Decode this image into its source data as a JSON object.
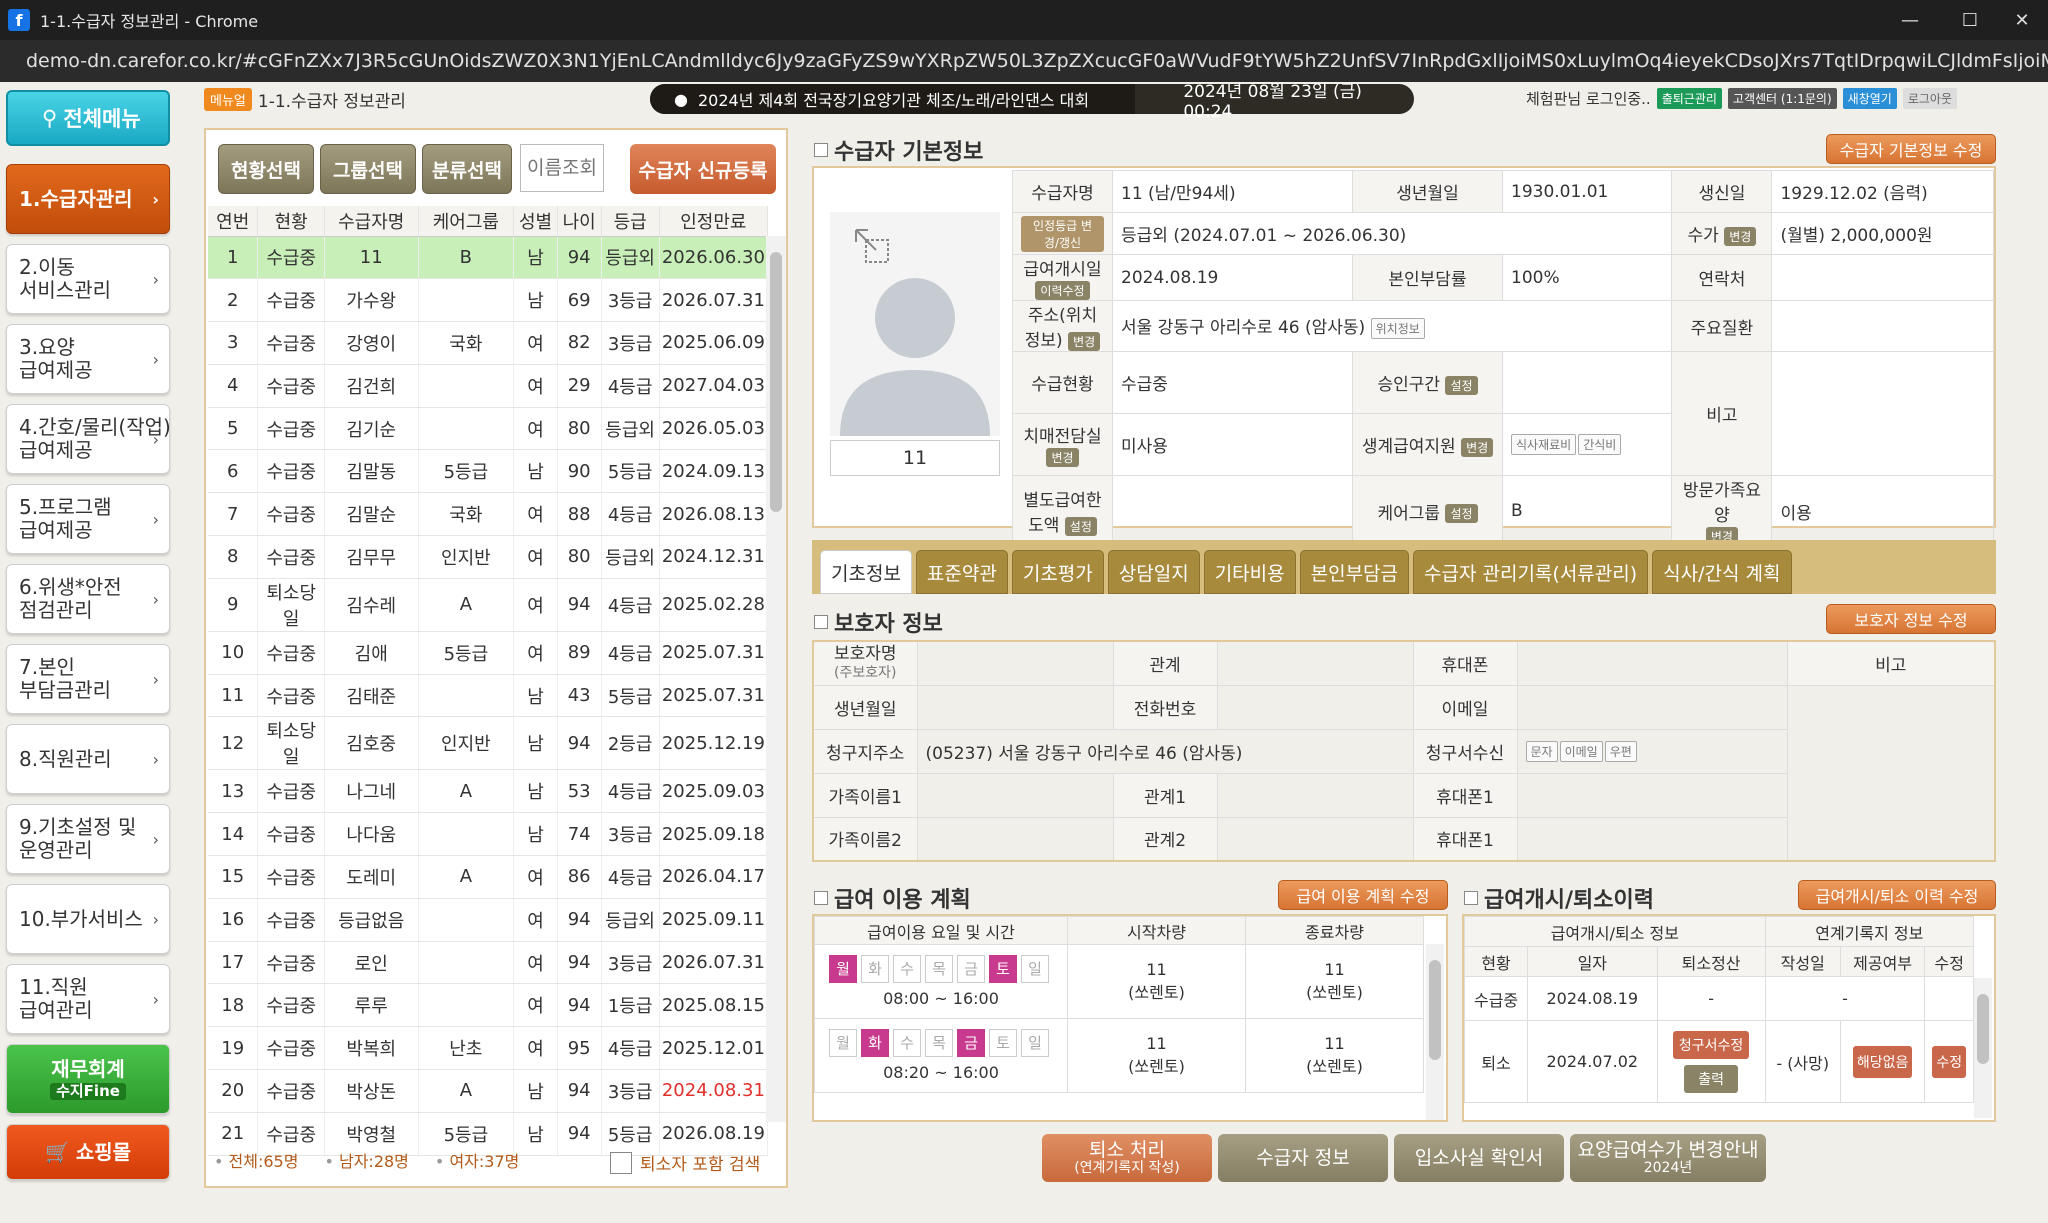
{
  "window": {
    "title": "1-1.수급자 정보관리 - Chrome",
    "url": "demo-dn.carefor.co.kr/#cGFnZXx7J3R5cGUnOidsZWZ0X3N1YjEnLCAndmlldyc6Jy9zaGFyZS9wYXRpZW50L3ZpZXcucGF0aWVudF9tYW5hZ2UnfSV7InRpdGxlIjoiMS0xLuylmOq4ieyekCDsoJXrs7TqtIDrpqwiLCJldmFsIjoiMSIsInNldHRpbmdzIjoiIn0="
  },
  "nav": {
    "menu_all": "전체메뉴",
    "items": [
      "1.수급자관리",
      "2.이동\n서비스관리",
      "3.요양\n급여제공",
      "4.간호/물리(작업)\n급여제공",
      "5.프로그램\n급여제공",
      "6.위생*안전\n점검관리",
      "7.본인\n부담금관리",
      "8.직원관리",
      "9.기초설정 및\n운영관리",
      "10.부가서비스",
      "11.직원\n급여관리"
    ],
    "finance": "재무회계",
    "finance_sub": "수지Fine",
    "shop": "쇼핑몰"
  },
  "header": {
    "menu_tag": "메뉴얼",
    "page": "1-1.수급자 정보관리",
    "notice": "2024년 제4회 전국장기요양기관 체조/노래/라인댄스 대회",
    "datetime": "2024년 08월 23일 (금) 00:24",
    "login": "체험판님 로그인중..",
    "btn1": "출퇴근관리",
    "btn2": "고객센터 (1:1문의)",
    "btn3": "새창열기",
    "btn4": "로그아웃"
  },
  "left": {
    "btns": [
      "현황선택",
      "그룹선택",
      "분류선택"
    ],
    "search_placeholder": "이름조회",
    "register": "수급자 신규등록",
    "cols": [
      "연번",
      "현황",
      "수급자명",
      "케어그룹",
      "성별",
      "나이",
      "등급",
      "인정만료"
    ],
    "rows": [
      [
        "1",
        "수급중",
        "11",
        "B",
        "남",
        "94",
        "등급외",
        "2026.06.30"
      ],
      [
        "2",
        "수급중",
        "가수왕",
        "",
        "남",
        "69",
        "3등급",
        "2026.07.31"
      ],
      [
        "3",
        "수급중",
        "강영이",
        "국화",
        "여",
        "82",
        "3등급",
        "2025.06.09"
      ],
      [
        "4",
        "수급중",
        "김건희",
        "",
        "여",
        "29",
        "4등급",
        "2027.04.03"
      ],
      [
        "5",
        "수급중",
        "김기순",
        "",
        "여",
        "80",
        "등급외",
        "2026.05.03"
      ],
      [
        "6",
        "수급중",
        "김말동",
        "5등급",
        "남",
        "90",
        "5등급",
        "2024.09.13"
      ],
      [
        "7",
        "수급중",
        "김말순",
        "국화",
        "여",
        "88",
        "4등급",
        "2026.08.13"
      ],
      [
        "8",
        "수급중",
        "김무무",
        "인지반",
        "여",
        "80",
        "등급외",
        "2024.12.31"
      ],
      [
        "9",
        "퇴소당일",
        "김수레",
        "A",
        "여",
        "94",
        "4등급",
        "2025.02.28"
      ],
      [
        "10",
        "수급중",
        "김애",
        "5등급",
        "여",
        "89",
        "4등급",
        "2025.07.31"
      ],
      [
        "11",
        "수급중",
        "김태준",
        "",
        "남",
        "43",
        "5등급",
        "2025.07.31"
      ],
      [
        "12",
        "퇴소당일",
        "김호중",
        "인지반",
        "남",
        "94",
        "2등급",
        "2025.12.19"
      ],
      [
        "13",
        "수급중",
        "나그네",
        "A",
        "남",
        "53",
        "4등급",
        "2025.09.03"
      ],
      [
        "14",
        "수급중",
        "나다움",
        "",
        "남",
        "74",
        "3등급",
        "2025.09.18"
      ],
      [
        "15",
        "수급중",
        "도레미",
        "A",
        "여",
        "86",
        "4등급",
        "2026.04.17"
      ],
      [
        "16",
        "수급중",
        "등급없음",
        "",
        "여",
        "94",
        "등급외",
        "2025.09.11"
      ],
      [
        "17",
        "수급중",
        "로인",
        "",
        "여",
        "94",
        "3등급",
        "2026.07.31"
      ],
      [
        "18",
        "수급중",
        "루루",
        "",
        "여",
        "94",
        "1등급",
        "2025.08.15"
      ],
      [
        "19",
        "수급중",
        "박복희",
        "난초",
        "여",
        "95",
        "4등급",
        "2025.12.01"
      ],
      [
        "20",
        "수급중",
        "박상돈",
        "A",
        "남",
        "94",
        "3등급",
        "2024.08.31"
      ],
      [
        "21",
        "수급중",
        "박영철",
        "5등급",
        "남",
        "94",
        "5등급",
        "2026.08.19"
      ]
    ],
    "total": "전체:65명",
    "male": "남자:28명",
    "female": "여자:37명",
    "retired_search": "퇴소자 포함 검색",
    "expired_color": "#e0302c"
  },
  "basic": {
    "title": "수급자 기본정보",
    "edit": "수급자 기본정보 수정",
    "photo_name": "11",
    "l_name": "수급자명",
    "v_name": "11 (남/만94세)",
    "l_birth": "생년월일",
    "v_birth": "1930.01.01",
    "l_bday": "생신일",
    "v_bday": "1929.12.02 (음력)",
    "b_grade": "인정등급 변경/갱신",
    "v_grade": "등급외 (2024.07.01 ~ 2026.06.30)",
    "l_fee": "수가",
    "b_fee": "변경",
    "v_fee": "(월별) 2,000,000원",
    "l_start": "급여개시일",
    "b_start": "이력수정",
    "v_start": "2024.08.19",
    "l_burden": "본인부담률",
    "v_burden": "100%",
    "l_contact": "연락처",
    "l_addr": "주소(위치정보)",
    "b_addr": "변경",
    "v_addr": "서울 강동구 아리수로 46 (암사동)",
    "b_loc": "위치정보",
    "l_disease": "주요질환",
    "l_status": "수급현황",
    "v_status": "수급중",
    "l_approve": "승인구간",
    "b_set": "설정",
    "l_note": "비고",
    "l_dementia": "치매전담실",
    "b_change": "변경",
    "v_dementia": "미사용",
    "l_living": "생계급여지원",
    "b_meal": "식사재료비",
    "b_snack": "간식비",
    "l_limit": "별도급여한도액",
    "l_group": "케어그룹",
    "v_group": "B",
    "l_visit": "방문가족요양",
    "v_visit": "이용"
  },
  "tabs": [
    "기초정보",
    "표준약관",
    "기초평가",
    "상담일지",
    "기타비용",
    "본인부담금",
    "수급자 관리기록(서류관리)",
    "식사/간식 계획"
  ],
  "guardian": {
    "title": "보호자 정보",
    "edit": "보호자 정보 수정",
    "l_name": "보호자명",
    "l_name_sub": "(주보호자)",
    "l_rel": "관계",
    "l_phone": "휴대폰",
    "l_note": "비고",
    "l_birth": "생년월일",
    "l_tel": "전화번호",
    "l_email": "이메일",
    "l_billaddr": "청구지주소",
    "v_billaddr": "(05237) 서울 강동구 아리수로 46 (암사동)",
    "l_billrecv": "청구서수신",
    "b_sms": "문자",
    "b_email": "이메일",
    "b_mail": "우편",
    "l_fam1": "가족이름1",
    "l_rel1": "관계1",
    "l_phone1": "휴대폰1",
    "l_fam2": "가족이름2",
    "l_rel2": "관계2",
    "l_phone2": "휴대폰1"
  },
  "plan": {
    "title": "급여 이용 계획",
    "edit": "급여 이용 계획 수정",
    "cols": [
      "급여이용 요일 및 시간",
      "시작차량",
      "종료차량"
    ],
    "days": [
      "월",
      "화",
      "수",
      "목",
      "금",
      "토",
      "일"
    ],
    "rows": [
      {
        "on": [
          true,
          false,
          false,
          false,
          false,
          true,
          false
        ],
        "time": "08:00 ~ 16:00",
        "start": "11",
        "start_sub": "(쏘렌토)",
        "end": "11",
        "end_sub": "(쏘렌토)"
      },
      {
        "on": [
          false,
          true,
          false,
          false,
          true,
          false,
          false
        ],
        "time": "08:20 ~ 16:00",
        "start": "11",
        "start_sub": "(쏘렌토)",
        "end": "11",
        "end_sub": "(쏘렌토)"
      }
    ]
  },
  "history": {
    "title": "급여개시/퇴소이력",
    "edit": "급여개시/퇴소 이력 수정",
    "h1": "급여개시/퇴소 정보",
    "h2": "연계기록지 정보",
    "cols": [
      "현황",
      "일자",
      "퇴소정산",
      "작성일",
      "제공여부",
      "수정"
    ],
    "r1": [
      "수급중",
      "2024.08.19",
      "-",
      "",
      "-",
      ""
    ],
    "r2_status": "퇴소",
    "r2_date": "2024.07.02",
    "r2_bill": "청구서수정",
    "r2_print": "출력",
    "r2_write": "- (사망)",
    "r2_none": "해당없음",
    "r2_edit": "수정"
  },
  "bottom": {
    "b1": "퇴소 처리",
    "b1_sub": "(연계기록지 작성)",
    "b2": "수급자 정보",
    "b3": "입소사실 확인서",
    "b4": "요양급여수가 변경안내",
    "b4_sub": "2024년"
  }
}
